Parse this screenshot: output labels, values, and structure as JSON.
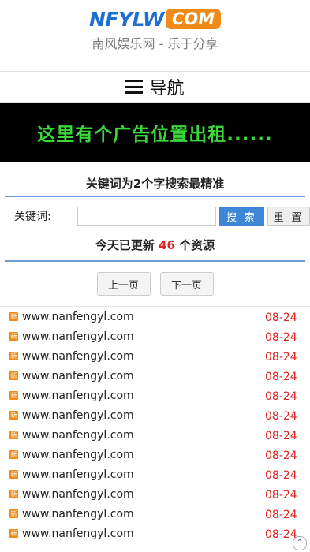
{
  "header": {
    "logo_main": "NFYLW",
    "logo_com": "COM",
    "slogan": "南风娱乐网 - 乐于分享"
  },
  "nav": {
    "label": "导航"
  },
  "ad": {
    "text": "这里有个广告位置出租......"
  },
  "search": {
    "hint": "关键词为2个字搜索最精准",
    "label": "关键词:",
    "value": "",
    "search_label": "搜 索",
    "reset_label": "重 置"
  },
  "update": {
    "prefix": "今天已更新",
    "count": "46",
    "suffix": "个资源"
  },
  "pager": {
    "prev": "上一页",
    "next": "下一页"
  },
  "list": [
    {
      "site": "www.nanfengyl.com",
      "date": "08-24"
    },
    {
      "site": "www.nanfengyl.com",
      "date": "08-24"
    },
    {
      "site": "www.nanfengyl.com",
      "date": "08-24"
    },
    {
      "site": "www.nanfengyl.com",
      "date": "08-24"
    },
    {
      "site": "www.nanfengyl.com",
      "date": "08-24"
    },
    {
      "site": "www.nanfengyl.com",
      "date": "08-24"
    },
    {
      "site": "www.nanfengyl.com",
      "date": "08-24"
    },
    {
      "site": "www.nanfengyl.com",
      "date": "08-24"
    },
    {
      "site": "www.nanfengyl.com",
      "date": "08-24"
    },
    {
      "site": "www.nanfengyl.com",
      "date": "08-24"
    },
    {
      "site": "www.nanfengyl.com",
      "date": "08-24"
    },
    {
      "site": "www.nanfengyl.com",
      "date": "08-24"
    }
  ],
  "icons": {
    "new": "新",
    "list_icon": "new-badge-icon",
    "menu": "menu-icon"
  }
}
